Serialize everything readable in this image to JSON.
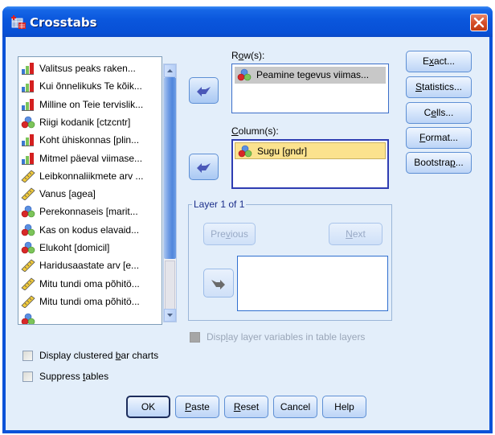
{
  "window": {
    "title": "Crosstabs",
    "close_label": "close"
  },
  "variables": {
    "items": [
      {
        "label": "Valitsus peaks raken...",
        "icon": "ordinal-icon"
      },
      {
        "label": "Kui õnnelikuks Te kõik...",
        "icon": "ordinal-icon"
      },
      {
        "label": "Milline on Teie tervislik...",
        "icon": "ordinal-icon"
      },
      {
        "label": "Riigi kodanik [ctzcntr]",
        "icon": "nominal-icon"
      },
      {
        "label": "Koht ühiskonnas [plin...",
        "icon": "ordinal-icon"
      },
      {
        "label": "Mitmel päeval viimase...",
        "icon": "ordinal-icon"
      },
      {
        "label": "Leibkonnaliikmete arv ...",
        "icon": "scale-icon"
      },
      {
        "label": "Vanus [agea]",
        "icon": "scale-icon"
      },
      {
        "label": "Perekonnaseis [marit...",
        "icon": "nominal-icon"
      },
      {
        "label": "Kas on kodus elavaid...",
        "icon": "nominal-icon"
      },
      {
        "label": "Elukoht [domicil]",
        "icon": "nominal-icon"
      },
      {
        "label": "Haridusaastate arv [e...",
        "icon": "scale-icon"
      },
      {
        "label": "Mitu tundi oma põhitö...",
        "icon": "scale-icon"
      },
      {
        "label": "Mitu tundi oma põhitö...",
        "icon": "scale-icon"
      }
    ]
  },
  "rows": {
    "label_pre": "R",
    "label_accel": "o",
    "label_post": "w(s):",
    "items": [
      {
        "label": "Peamine tegevus viimas...",
        "icon": "nominal-icon"
      }
    ]
  },
  "columns": {
    "label_pre": "",
    "label_accel": "C",
    "label_post": "olumn(s):",
    "items": [
      {
        "label": "Sugu [gndr]",
        "icon": "nominal-icon"
      }
    ]
  },
  "layer": {
    "title": "Layer 1 of 1",
    "previous": {
      "pre": "Pre",
      "accel": "v",
      "post": "ious"
    },
    "next": {
      "pre": "",
      "accel": "N",
      "post": "ext"
    },
    "display_layer_vars": {
      "pre": "Disp",
      "accel": "l",
      "post": "ay layer variables in table layers",
      "checked": false,
      "enabled": false
    }
  },
  "side_buttons": [
    {
      "pre": "E",
      "accel": "x",
      "post": "act..."
    },
    {
      "pre": "",
      "accel": "S",
      "post": "tatistics..."
    },
    {
      "pre": "C",
      "accel": "e",
      "post": "lls..."
    },
    {
      "pre": "",
      "accel": "F",
      "post": "ormat..."
    },
    {
      "pre": "Bootstra",
      "accel": "p",
      "post": "..."
    }
  ],
  "options": {
    "clustered_bar": {
      "pre": "Display clustered ",
      "accel": "b",
      "post": "ar charts",
      "checked": false
    },
    "suppress_tables": {
      "pre": "Suppress ",
      "accel": "t",
      "post": "ables",
      "checked": false
    }
  },
  "bottom_buttons": {
    "ok": {
      "pre": "OK",
      "accel": "",
      "post": ""
    },
    "paste": {
      "pre": "",
      "accel": "P",
      "post": "aste"
    },
    "reset": {
      "pre": "",
      "accel": "R",
      "post": "eset"
    },
    "cancel": {
      "pre": "Cancel",
      "accel": "",
      "post": ""
    },
    "help": {
      "pre": "Help",
      "accel": "",
      "post": ""
    }
  },
  "colors": {
    "titlebar": "#0a56dc",
    "client": "#e3eefa",
    "row_selection": "#c8c8c8",
    "column_selection": "#fbe28e",
    "focus_border": "#2f3db2"
  }
}
